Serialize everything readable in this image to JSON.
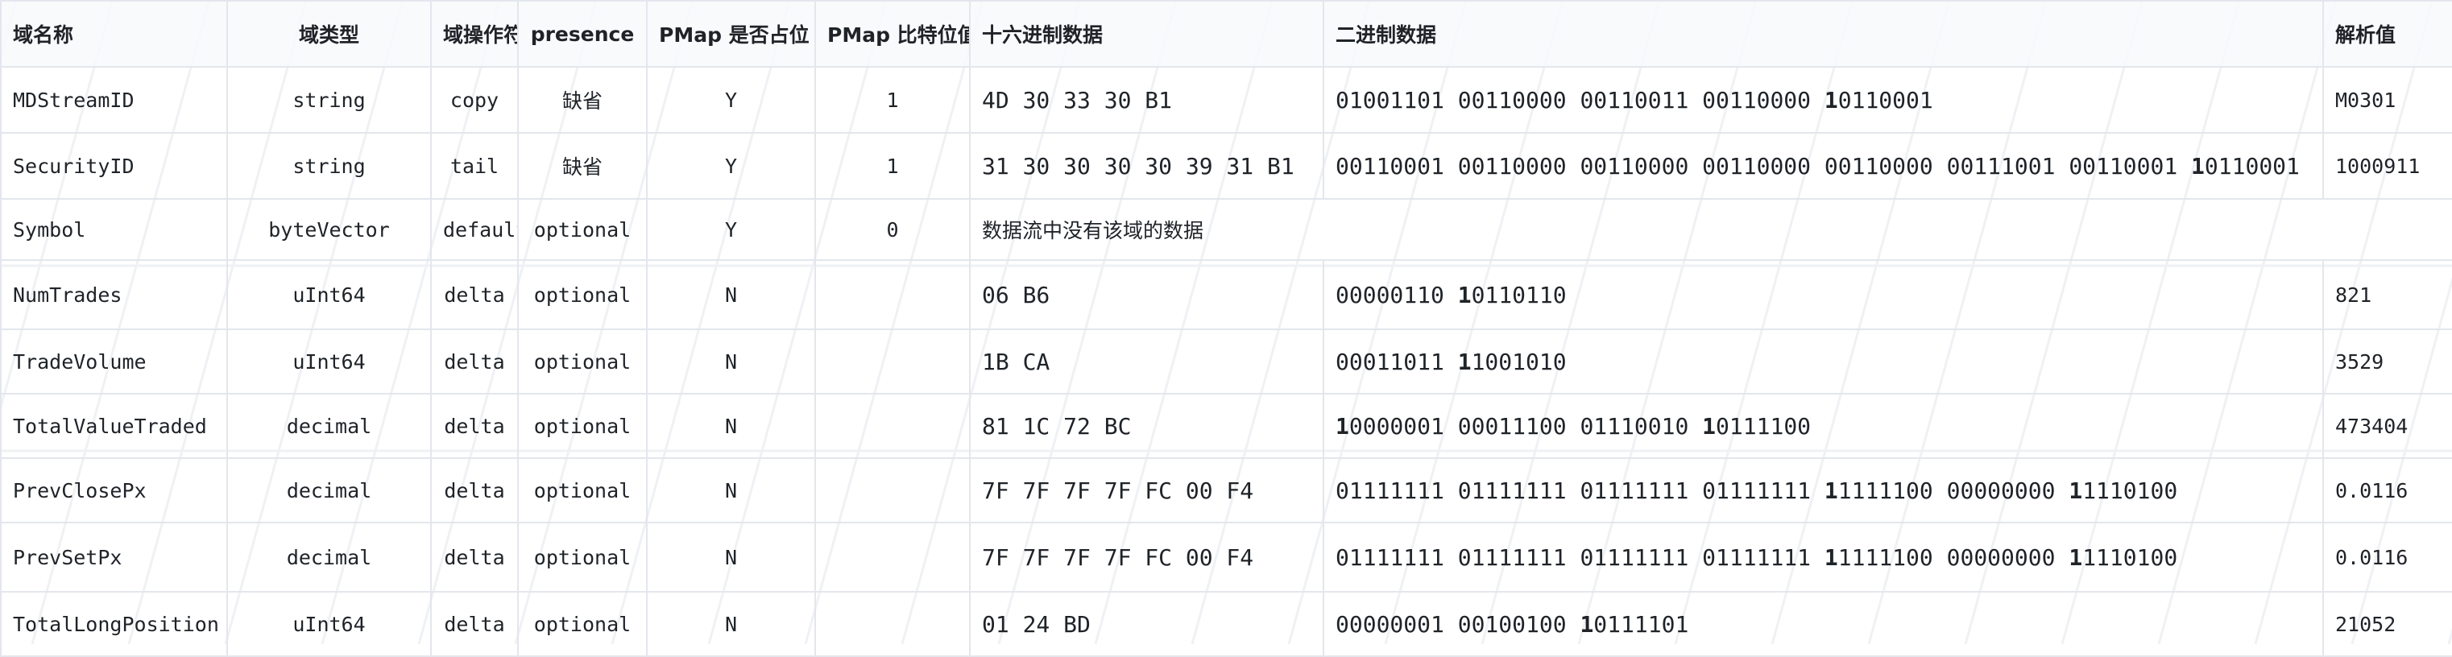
{
  "headers": {
    "name": "域名称",
    "type": "域类型",
    "operator": "域操作符",
    "presence": "presence",
    "pmap_present": "PMap 是否占位",
    "pmap_bit": "PMap 比特位值",
    "hex": "十六进制数据",
    "binary": "二进制数据",
    "parsed": "解析值"
  },
  "rows": [
    {
      "name": "MDStreamID",
      "type": "string",
      "operator": "copy",
      "presence": "缺省",
      "pmap_present": "Y",
      "pmap_bit": "1",
      "hex": "4D 30 33 30 B1",
      "bin_groups": [
        "01001101",
        "00110000",
        "00110011",
        "00110000",
        "10110001"
      ],
      "parsed": "M0301"
    },
    {
      "name": "SecurityID",
      "type": "string",
      "operator": "tail",
      "presence": "缺省",
      "pmap_present": "Y",
      "pmap_bit": "1",
      "hex": "31 30 30 30 30 39 31 B1",
      "bin_groups": [
        "00110001",
        "00110000",
        "00110000",
        "00110000",
        "00110000",
        "00111001",
        "00110001",
        "10110001"
      ],
      "parsed": "1000911"
    },
    {
      "name": "Symbol",
      "type": "byteVector",
      "operator": "default",
      "presence": "optional",
      "pmap_present": "Y",
      "pmap_bit": "0",
      "note": "数据流中没有该域的数据"
    },
    {
      "name": "NumTrades",
      "type": "uInt64",
      "operator": "delta",
      "presence": "optional",
      "pmap_present": "N",
      "pmap_bit": "",
      "hex": "06 B6",
      "bin_groups": [
        "00000110",
        "10110110"
      ],
      "parsed": "821"
    },
    {
      "name": "TradeVolume",
      "type": "uInt64",
      "operator": "delta",
      "presence": "optional",
      "pmap_present": "N",
      "pmap_bit": "",
      "hex": "1B CA",
      "bin_groups": [
        "00011011",
        "11001010"
      ],
      "parsed": "3529"
    },
    {
      "name": "TotalValueTraded",
      "type": "decimal",
      "operator": "delta",
      "presence": "optional",
      "pmap_present": "N",
      "pmap_bit": "",
      "hex": "81 1C 72 BC",
      "bin_groups": [
        "10000001",
        "00011100",
        "01110010",
        "10111100"
      ],
      "parsed": "473404"
    },
    {
      "name": "PrevClosePx",
      "type": "decimal",
      "operator": "delta",
      "presence": "optional",
      "pmap_present": "N",
      "pmap_bit": "",
      "hex": "7F 7F 7F 7F FC 00 F4",
      "bin_groups": [
        "01111111",
        "01111111",
        "01111111",
        "01111111",
        "11111100",
        "00000000",
        "11110100"
      ],
      "parsed": "0.0116"
    },
    {
      "name": "PrevSetPx",
      "type": "decimal",
      "operator": "delta",
      "presence": "optional",
      "pmap_present": "N",
      "pmap_bit": "",
      "hex": "7F 7F 7F 7F FC 00 F4",
      "bin_groups": [
        "01111111",
        "01111111",
        "01111111",
        "01111111",
        "11111100",
        "00000000",
        "11110100"
      ],
      "parsed": "0.0116"
    },
    {
      "name": "TotalLongPosition",
      "type": "uInt64",
      "operator": "delta",
      "presence": "optional",
      "pmap_present": "N",
      "pmap_bit": "",
      "hex": "01 24 BD",
      "bin_groups": [
        "00000001",
        "00100100",
        "10111101"
      ],
      "parsed": "21052"
    }
  ]
}
